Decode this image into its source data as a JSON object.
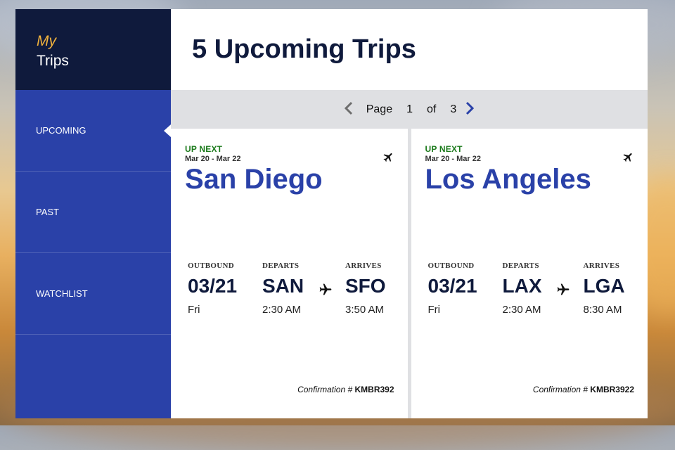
{
  "sidebar": {
    "brand_my": "My",
    "brand_trips": "Trips",
    "items": [
      {
        "label": "UPCOMING",
        "active": true
      },
      {
        "label": "PAST",
        "active": false
      },
      {
        "label": "WATCHLIST",
        "active": false
      }
    ]
  },
  "header": {
    "title": "5 Upcoming Trips"
  },
  "pager": {
    "page_label": "Page",
    "current": "1",
    "of_label": "of",
    "total": "3"
  },
  "trips": [
    {
      "badge": "UP NEXT",
      "dates": "Mar 20 - Mar 22",
      "city": "San Diego",
      "outbound_label": "OUTBOUND",
      "departs_label": "DEPARTS",
      "arrives_label": "ARRIVES",
      "date": "03/21",
      "day": "Fri",
      "from": "SAN",
      "depart_time": "2:30 AM",
      "to": "SFO",
      "arrive_time": "3:50 AM",
      "confirmation_label": "Confirmation #",
      "confirmation_code": "KMBR392"
    },
    {
      "badge": "UP NEXT",
      "dates": "Mar 20 - Mar 22",
      "city": "Los Angeles",
      "outbound_label": "OUTBOUND",
      "departs_label": "DEPARTS",
      "arrives_label": "ARRIVES",
      "date": "03/21",
      "day": "Fri",
      "from": "LAX",
      "depart_time": "2:30 AM",
      "to": "LGA",
      "arrive_time": "8:30 AM",
      "confirmation_label": "Confirmation #",
      "confirmation_code": "KMBR3922"
    }
  ],
  "colors": {
    "brand_navy": "#0f1a3c",
    "sidebar_blue": "#2a41a8",
    "accent_gold": "#f2b33d",
    "up_next_green": "#1b7a1b"
  },
  "icons": {
    "trip_icon": "airplane-icon",
    "prev": "chevron-left-icon",
    "next": "chevron-right-icon"
  }
}
